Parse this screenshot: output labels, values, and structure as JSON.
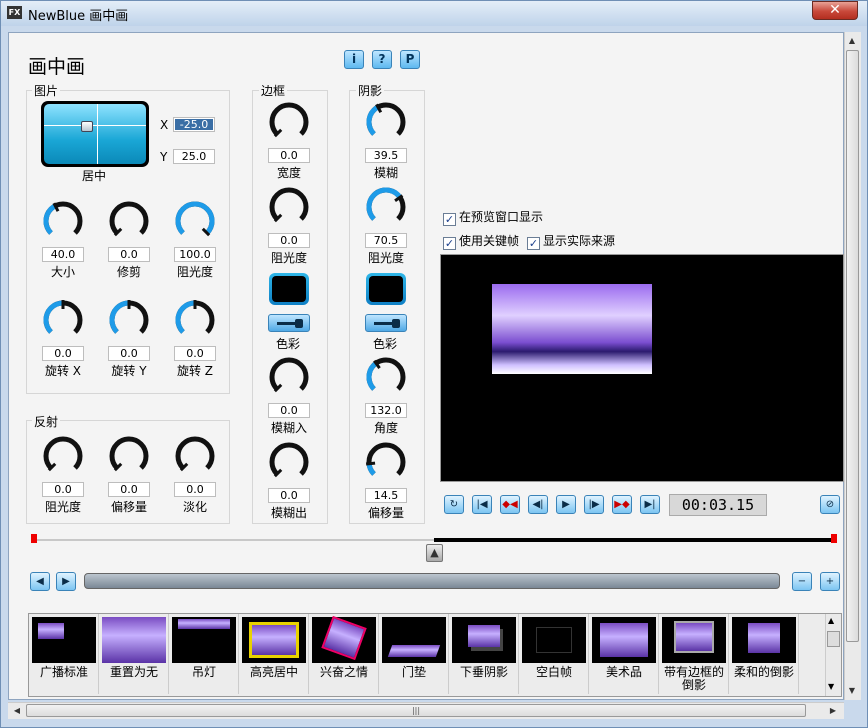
{
  "window": {
    "title": "NewBlue 画中画",
    "app_icon": "FX"
  },
  "main_title": "画中画",
  "top_buttons": [
    "i",
    "?",
    "P"
  ],
  "picture": {
    "group_title": "图片",
    "position_label": "居中",
    "x_label": "X",
    "x_value": "-25.0",
    "y_label": "Y",
    "y_value": "25.0",
    "knobs": [
      {
        "value": "40.0",
        "label": "大小",
        "fraction": 0.4
      },
      {
        "value": "0.0",
        "label": "修剪",
        "fraction": 0.0
      },
      {
        "value": "100.0",
        "label": "阻光度",
        "fraction": 1.0
      },
      {
        "value": "0.0",
        "label": "旋转 X",
        "fraction": 0.5
      },
      {
        "value": "0.0",
        "label": "旋转 Y",
        "fraction": 0.5
      },
      {
        "value": "0.0",
        "label": "旋转 Z",
        "fraction": 0.5
      }
    ]
  },
  "reflection": {
    "group_title": "反射",
    "knobs": [
      {
        "value": "0.0",
        "label": "阻光度",
        "fraction": 0.0
      },
      {
        "value": "0.0",
        "label": "偏移量",
        "fraction": 0.0
      },
      {
        "value": "0.0",
        "label": "淡化",
        "fraction": 0.0
      }
    ]
  },
  "border": {
    "group_title": "边框",
    "knobs": [
      {
        "value": "0.0",
        "label": "宽度",
        "fraction": 0.0
      },
      {
        "value": "0.0",
        "label": "阻光度",
        "fraction": 0.0
      },
      {
        "value": "0.0",
        "label": "模糊入",
        "fraction": 0.0
      },
      {
        "value": "0.0",
        "label": "模糊出",
        "fraction": 0.0
      }
    ],
    "color_label": "色彩"
  },
  "shadow": {
    "group_title": "阴影",
    "knobs": [
      {
        "value": "39.5",
        "label": "模糊",
        "fraction": 0.395
      },
      {
        "value": "70.5",
        "label": "阻光度",
        "fraction": 0.705
      },
      {
        "value": "132.0",
        "label": "角度",
        "fraction": 0.367
      },
      {
        "value": "14.5",
        "label": "偏移量",
        "fraction": 0.145
      }
    ],
    "color_label": "色彩"
  },
  "options": {
    "preview_window": "在预览窗口显示",
    "use_keyframes": "使用关键帧",
    "show_source": "显示实际来源"
  },
  "playback": {
    "timecode": "00:03.15"
  },
  "presets": [
    {
      "label": "广播标准"
    },
    {
      "label": "重置为无"
    },
    {
      "label": "吊灯"
    },
    {
      "label": "高亮居中"
    },
    {
      "label": "兴奋之情"
    },
    {
      "label": "门垫"
    },
    {
      "label": "下垂阴影"
    },
    {
      "label": "空白帧"
    },
    {
      "label": "美术品"
    },
    {
      "label": "带有边框的倒影"
    },
    {
      "label": "柔和的倒影"
    }
  ],
  "colors": {
    "accent": "#1e9be8",
    "knob_dark": "#111111"
  }
}
